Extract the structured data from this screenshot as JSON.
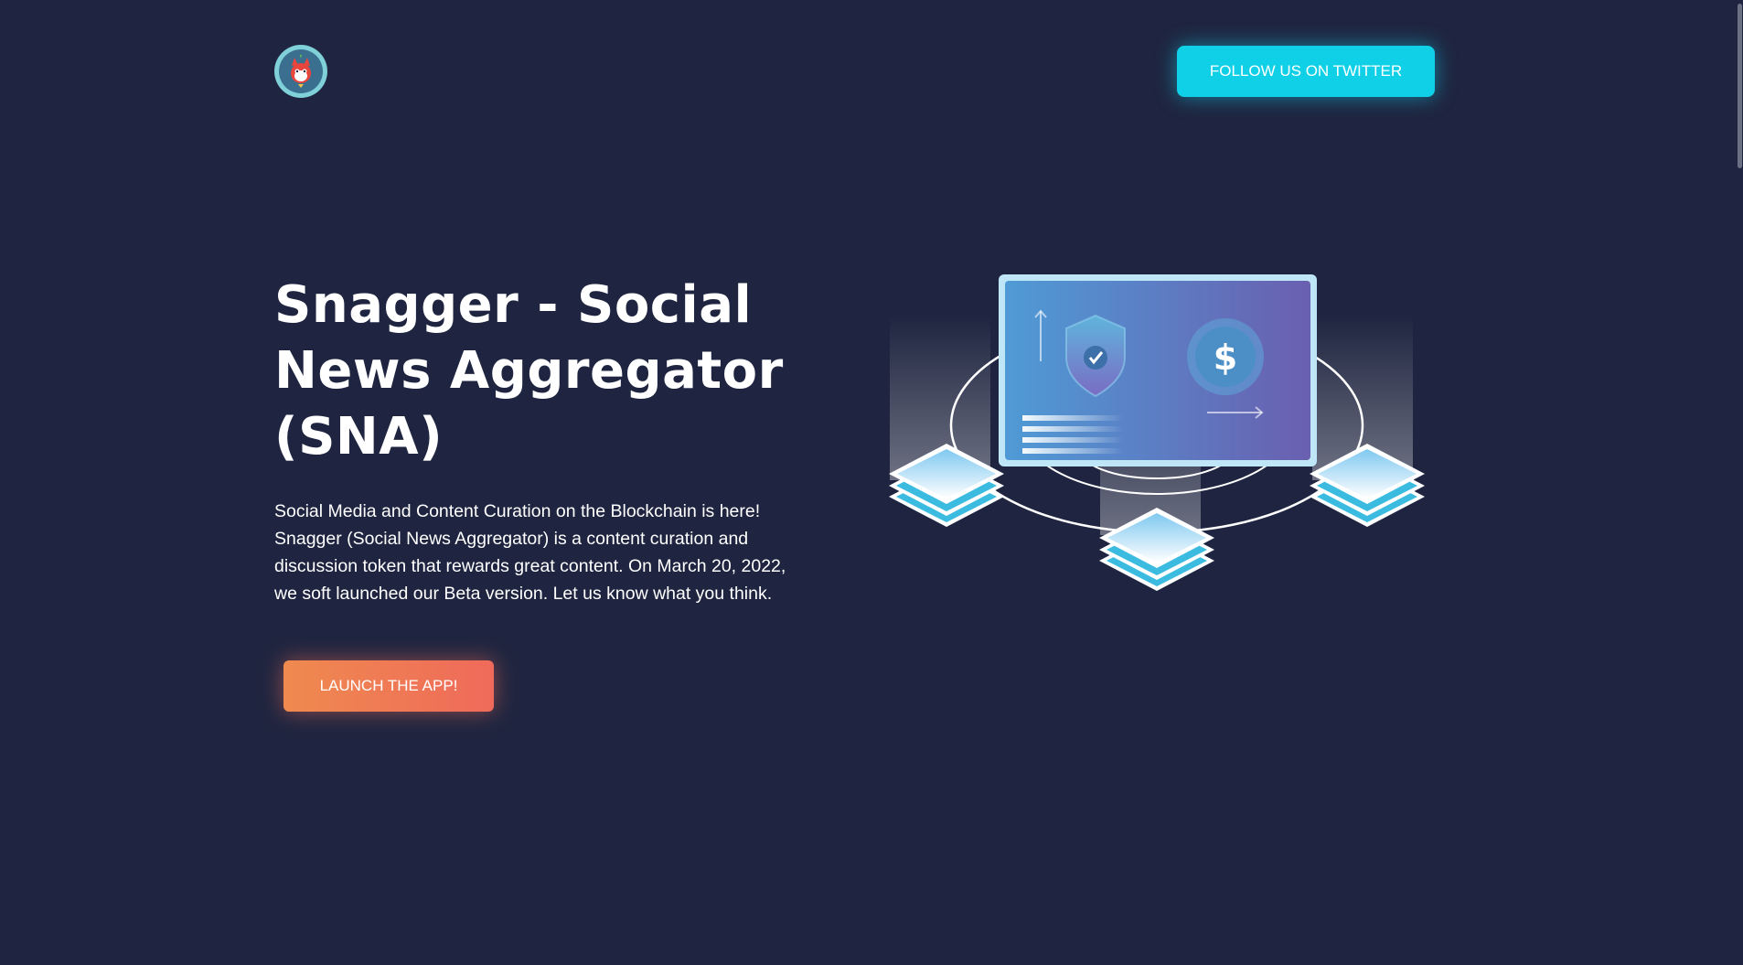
{
  "header": {
    "logo_icon": "squirrel-mascot-icon",
    "twitter_button_label": "FOLLOW US ON TWITTER"
  },
  "hero": {
    "title": "Snagger - Social News Aggregator (SNA)",
    "description": "Social Media and Content Curation on the Blockchain is here! Snagger (Social News Aggregator) is a content curation and discussion token that rewards great content. On March 20, 2022, we soft launched our Beta version. Let us know what you think.",
    "launch_button_label": "LAUNCH THE APP!"
  },
  "illustration": {
    "shield_icon": "shield-check-icon",
    "dollar_icon": "dollar-coin-icon",
    "dollar_symbol": "$",
    "block_icon": "stacked-blocks-icon"
  },
  "colors": {
    "background": "#1f2540",
    "twitter_button": "#0fd0e6",
    "launch_button_start": "#ef8a4f",
    "launch_button_end": "#ef6a5a",
    "screen_gradient_start": "#4f9bd6",
    "screen_gradient_end": "#6a5fb0"
  }
}
